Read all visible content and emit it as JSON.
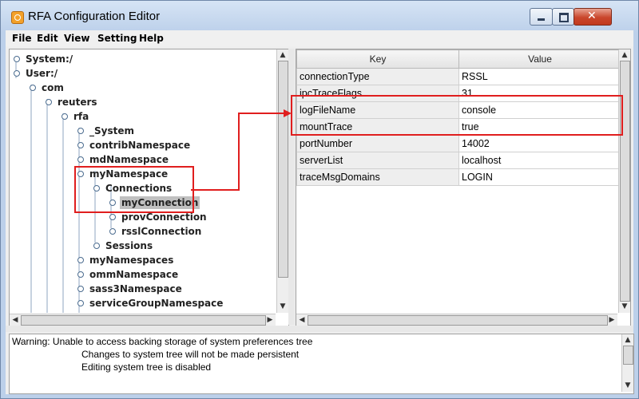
{
  "window": {
    "title": "RFA Configuration Editor"
  },
  "menu": [
    "File",
    "Edit",
    "View",
    "Setting",
    "Help"
  ],
  "tree": [
    {
      "label": "System:/",
      "depth": 0
    },
    {
      "label": "User:/",
      "depth": 0
    },
    {
      "label": "com",
      "depth": 1
    },
    {
      "label": "reuters",
      "depth": 2
    },
    {
      "label": "rfa",
      "depth": 3
    },
    {
      "label": "_System",
      "depth": 4
    },
    {
      "label": "contribNamespace",
      "depth": 4
    },
    {
      "label": "mdNamespace",
      "depth": 4
    },
    {
      "label": "myNamespace",
      "depth": 4
    },
    {
      "label": "Connections",
      "depth": 5
    },
    {
      "label": "myConnection",
      "depth": 6,
      "selected": true
    },
    {
      "label": "provConnection",
      "depth": 6
    },
    {
      "label": "rsslConnection",
      "depth": 6
    },
    {
      "label": "Sessions",
      "depth": 5
    },
    {
      "label": "myNamespaces",
      "depth": 4
    },
    {
      "label": "ommNamespace",
      "depth": 4
    },
    {
      "label": "sass3Namespace",
      "depth": 4
    },
    {
      "label": "serviceGroupNamespace",
      "depth": 4
    }
  ],
  "table": {
    "headers": [
      "Key",
      "Value"
    ],
    "rows": [
      {
        "key": "connectionType",
        "value": "RSSL"
      },
      {
        "key": "ipcTraceFlags",
        "value": "31"
      },
      {
        "key": "logFileName",
        "value": "console"
      },
      {
        "key": "mountTrace",
        "value": "true"
      },
      {
        "key": "portNumber",
        "value": "14002"
      },
      {
        "key": "serverList",
        "value": "localhost"
      },
      {
        "key": "traceMsgDomains",
        "value": "LOGIN"
      }
    ]
  },
  "log": {
    "lines": [
      "Warning: Unable to access backing storage of system preferences tree",
      "Changes to system tree will not be made persistent",
      "Editing system tree is disabled"
    ]
  },
  "colors": {
    "annotation": "#e01e1e",
    "selection": "#c0c0c0"
  }
}
